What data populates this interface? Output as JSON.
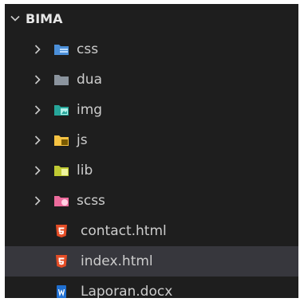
{
  "explorer": {
    "root": {
      "label": "BIMA",
      "icon": "chevron-down-icon"
    },
    "items": [
      {
        "type": "folder",
        "label": "css",
        "icon": "css-folder-icon",
        "color": "#4b8fd9"
      },
      {
        "type": "folder",
        "label": "dua",
        "icon": "folder-icon",
        "color": "#8b949e"
      },
      {
        "type": "folder",
        "label": "img",
        "icon": "image-folder-icon",
        "color": "#26a69a"
      },
      {
        "type": "folder",
        "label": "js",
        "icon": "js-folder-icon",
        "color": "#f5c242"
      },
      {
        "type": "folder",
        "label": "lib",
        "icon": "lib-folder-icon",
        "color": "#c0ca33"
      },
      {
        "type": "folder",
        "label": "scss",
        "icon": "scss-folder-icon",
        "color": "#ec6b9c"
      },
      {
        "type": "file",
        "label": "contact.html",
        "icon": "html5-icon",
        "color": "#e44d26"
      },
      {
        "type": "file",
        "label": "index.html",
        "icon": "html5-icon",
        "color": "#e44d26",
        "selected": true
      },
      {
        "type": "file",
        "label": "Laporan.docx",
        "icon": "word-doc-icon",
        "color": "#1f6fd1"
      }
    ]
  },
  "colors": {
    "background": "#1e1e1e",
    "selection": "#37373d",
    "text": "#cccccc"
  }
}
